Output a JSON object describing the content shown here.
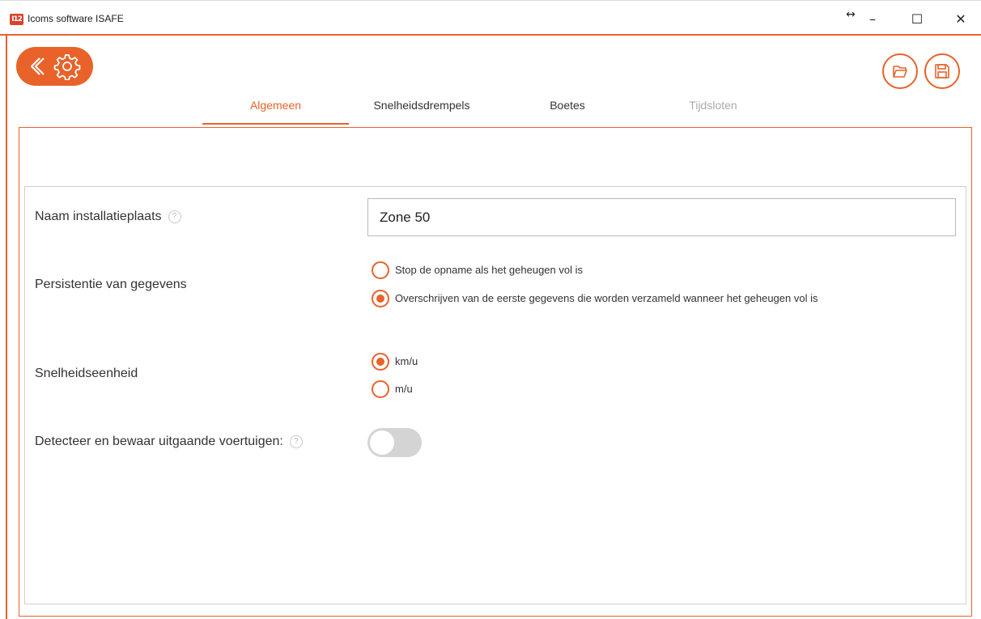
{
  "window": {
    "title": "Icoms software ISAFE",
    "app_icon_text": "I12",
    "controls": {
      "resize": "↔",
      "minimize": "–",
      "maximize": "☐",
      "close": "✕"
    }
  },
  "toolbar": {
    "back_icon": "chevron-left-icon",
    "settings_icon": "gear-icon",
    "open_icon": "folder-open-icon",
    "save_icon": "save-icon"
  },
  "tabs": [
    {
      "label": "Algemeen",
      "state": "active"
    },
    {
      "label": "Snelheidsdrempels",
      "state": "normal"
    },
    {
      "label": "Boetes",
      "state": "normal"
    },
    {
      "label": "Tijdsloten",
      "state": "disabled"
    }
  ],
  "form": {
    "location_name": {
      "label": "Naam installatieplaats",
      "value": "Zone 50",
      "help_icon": "help-icon"
    },
    "persistence": {
      "label": "Persistentie van gegevens",
      "options": [
        {
          "label": "Stop de opname als het geheugen vol is",
          "selected": false
        },
        {
          "label": "Overschrijven van de eerste gegevens die worden verzameld wanneer het geheugen vol is",
          "selected": true
        }
      ]
    },
    "speed_unit": {
      "label": "Snelheidseenheid",
      "options": [
        {
          "label": "km/u",
          "selected": true
        },
        {
          "label": "m/u",
          "selected": false
        }
      ]
    },
    "outgoing_vehicles": {
      "label": "Detecteer en bewaar uitgaande voertuigen:",
      "help_icon": "help-icon",
      "enabled": false
    }
  },
  "colors": {
    "accent": "#e8622a",
    "border": "#cfcfcf",
    "toggle_off": "#d4d4d4"
  }
}
